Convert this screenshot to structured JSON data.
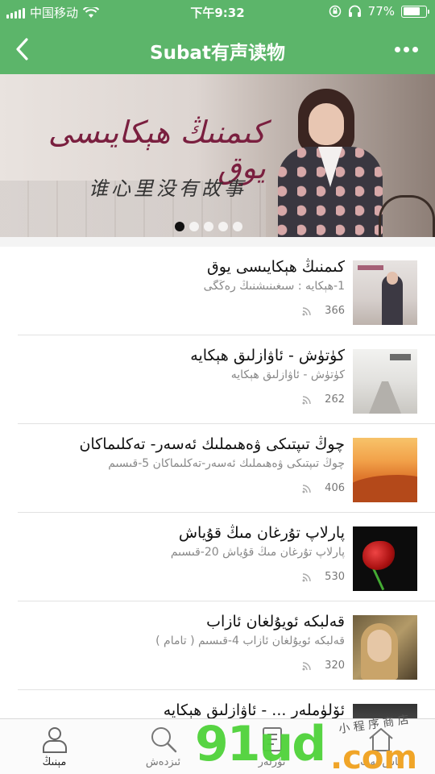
{
  "status_bar": {
    "carrier": "中国移动",
    "time": "下午9:32",
    "battery": "77%",
    "battery_level": 0.77
  },
  "nav": {
    "title": "Subat有声读物",
    "back_icon": "chevron-left-icon",
    "more_icon": "more-dots-icon"
  },
  "banner": {
    "title": "كىمنىڭ ھېكايىسى يوق",
    "subtitle": "谁心里没有故事",
    "dot_count": 5,
    "active_dot": 0
  },
  "items": [
    {
      "title": "كىمنىڭ ھېكايىسى يوق",
      "subtitle": "1-ھېكايە : سىغىنىشنىڭ رەڭگى",
      "count": "366"
    },
    {
      "title": "كۈتۈش - ئاۋازلىق ھېكايە",
      "subtitle": "كۈتۈش - ئاۋازلىق ھېكايە",
      "count": "262"
    },
    {
      "title": "چوڭ تىپتىكى ۋەھىملىك ئەسەر- تەكلىماكان",
      "subtitle": "چوڭ تىپتىكى ۋەھىملىك ئەسەر-تەكلىماكان 5-قىسىم",
      "count": "406"
    },
    {
      "title": "پارلاپ تۇرغان مىڭ قۇياش",
      "subtitle": "پارلاپ تۇرغان مىڭ قۇياش 20-قىسىم",
      "count": "530"
    },
    {
      "title": "قەلبكە ئويۇلغان ئازاب",
      "subtitle": "قەلبكە ئويۇلغان ئازاب 4-قىسىم ( تامام )",
      "count": "320"
    },
    {
      "title": "ئۆلۈملەر ... - ئاۋازلىق ھېكايە",
      "subtitle": "",
      "count": ""
    }
  ],
  "tabs": [
    {
      "label": "مېنىڭ",
      "icon": "user-icon"
    },
    {
      "label": "ئىزدەش",
      "icon": "search-icon"
    },
    {
      "label": "تۈرلەر",
      "icon": "category-icon"
    },
    {
      "label": "باش بەت",
      "icon": "home-icon"
    }
  ],
  "watermark": {
    "site": "91ud",
    "tld": ".com",
    "caption": "小 程 序 商 店"
  }
}
